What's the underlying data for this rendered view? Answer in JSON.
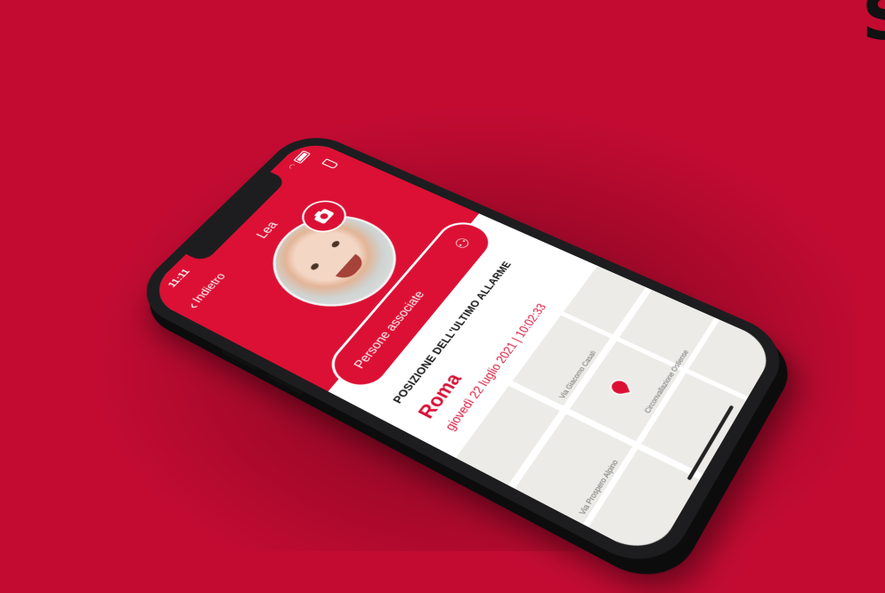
{
  "status_bar": {
    "time": "11:11"
  },
  "nav": {
    "back_label": "Indietro",
    "title": "Lea"
  },
  "icons": {
    "back": "chevron-left-icon",
    "camera": "camera-icon",
    "add_person": "person-add-icon",
    "battery": "battery-icon",
    "wifi": "wifi-icon",
    "map_pin": "map-pin-icon"
  },
  "card": {
    "label": "Persone associate"
  },
  "alarm": {
    "section_title": "POSIZIONE DELL'ULTIMO ALLARME",
    "city": "Roma",
    "datetime": "giovedì 22 luglio 2021 | 10:02:33"
  },
  "map": {
    "streets": [
      "Via Giacomo Casali",
      "Circonvallazione Ostiense",
      "Via Prospero Alpino"
    ]
  },
  "colors": {
    "background": "#c30b32",
    "accent": "#dc1034",
    "phone": "#1d1d1f"
  }
}
